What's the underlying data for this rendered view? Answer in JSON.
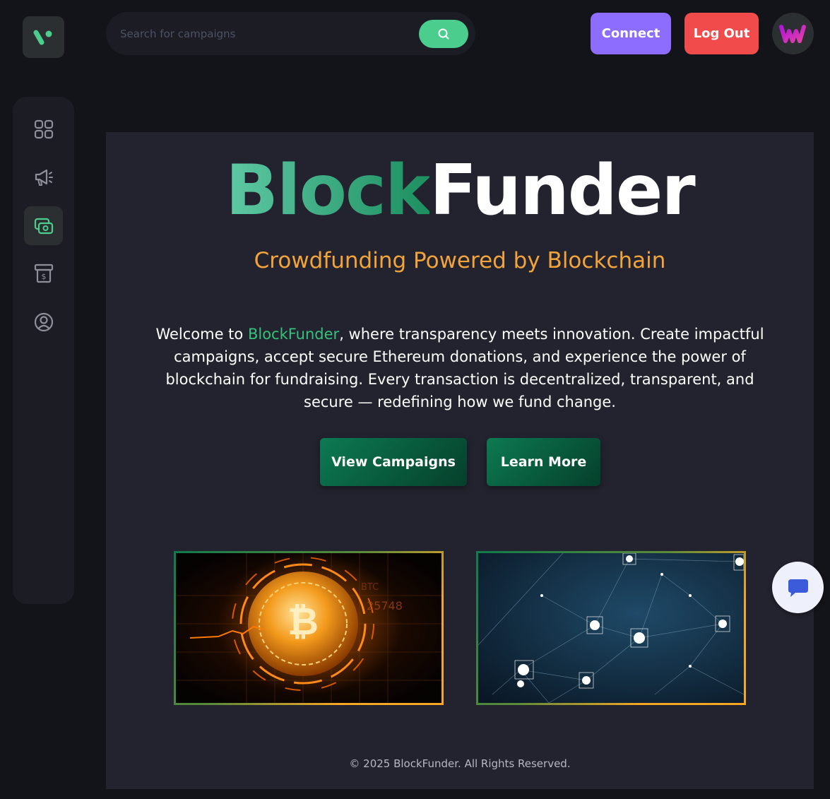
{
  "header": {
    "logo_icon": "brand-logo-icon",
    "search": {
      "placeholder": "Search for campaigns",
      "value": "",
      "button_icon": "search-icon"
    },
    "connect_label": "Connect",
    "logout_label": "Log Out",
    "avatar_icon": "user-avatar-logo"
  },
  "sidebar": {
    "items": [
      {
        "icon": "dashboard-grid-icon",
        "active": false
      },
      {
        "icon": "megaphone-icon",
        "active": false
      },
      {
        "icon": "payment-icon",
        "active": true
      },
      {
        "icon": "withdraw-icon",
        "active": false
      },
      {
        "icon": "profile-icon",
        "active": false
      }
    ]
  },
  "hero": {
    "title_part1": "Block",
    "title_part2": "Funder",
    "subtitle": "Crowdfunding Powered by Blockchain",
    "intro_before": "Welcome to ",
    "intro_brand": "BlockFunder",
    "intro_after": ", where transparency meets innovation. Create impactful campaigns, accept secure Ethereum donations, and experience the power of blockchain for fundraising. Every transaction is decentralized, transparent, and secure — redefining how we fund change.",
    "view_campaigns_label": "View Campaigns",
    "learn_more_label": "Learn More"
  },
  "images": [
    {
      "name": "bitcoin-coin-image"
    },
    {
      "name": "blockchain-network-image"
    }
  ],
  "footer": {
    "copyright": "© 2025 BlockFunder. All Rights Reserved."
  },
  "chat": {
    "icon": "chat-icon"
  },
  "colors": {
    "background": "#13131a",
    "panel": "#23232f",
    "accent_green": "#4acd8d",
    "connect": "#8c6dfd",
    "logout": "#f24b4b",
    "subtitle": "#f2a33a"
  }
}
